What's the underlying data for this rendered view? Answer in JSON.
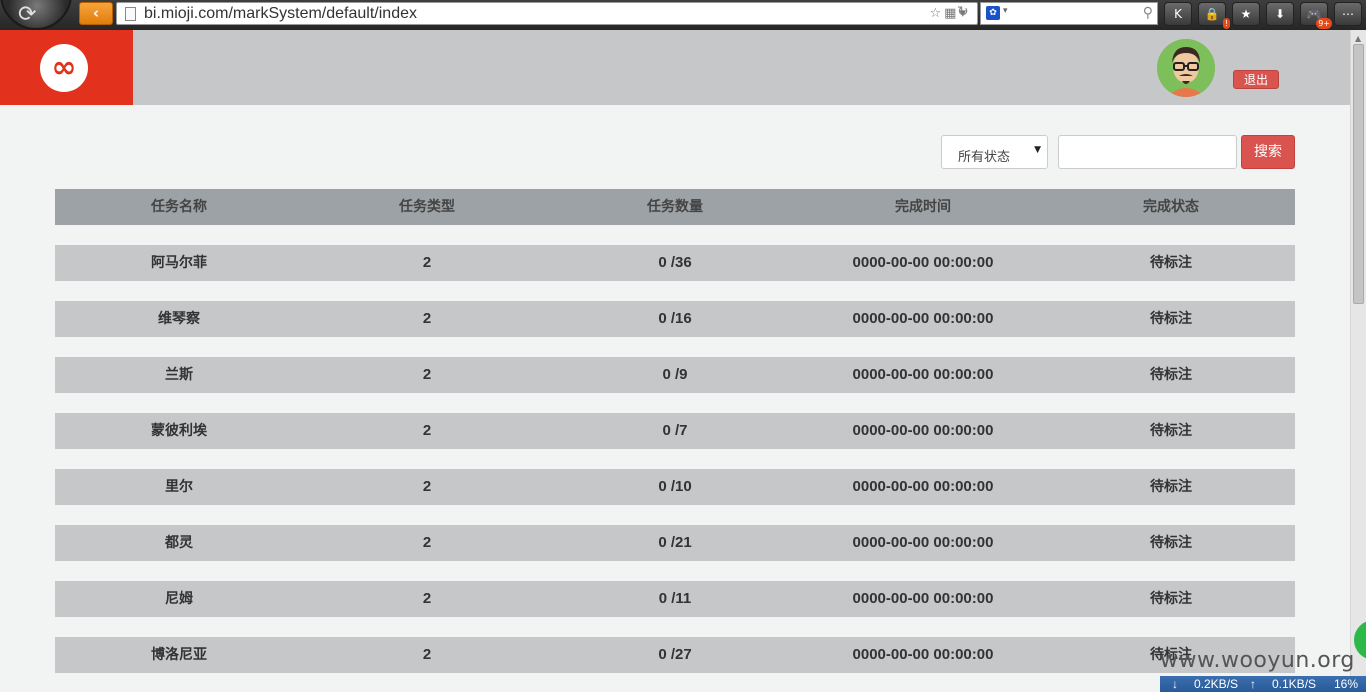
{
  "browser": {
    "url": "bi.mioji.com/markSystem/default/index",
    "back_icon": "‹",
    "search_engine_icon": "paw-icon",
    "toolbar_buttons": [
      {
        "name": "k-extension-button",
        "glyph": "K",
        "badge": ""
      },
      {
        "name": "lock-button",
        "glyph": "🔒",
        "badge": "!"
      },
      {
        "name": "bookmark-star-button",
        "glyph": "★",
        "badge": ""
      },
      {
        "name": "download-button",
        "glyph": "⬇",
        "badge": ""
      },
      {
        "name": "game-button",
        "glyph": "🎮",
        "badge": "9+"
      },
      {
        "name": "more-button",
        "glyph": "⋯",
        "badge": ""
      }
    ]
  },
  "header": {
    "logo_glyph": "∞",
    "logout_label": "退出"
  },
  "filters": {
    "status_select_value": "所有状态",
    "search_value": "",
    "search_button_label": "搜索"
  },
  "table": {
    "columns": [
      "任务名称",
      "任务类型",
      "任务数量",
      "完成时间",
      "完成状态"
    ],
    "rows": [
      {
        "name": "阿马尔菲",
        "type": "2",
        "count": "0 /36",
        "time": "0000-00-00 00:00:00",
        "status": "待标注"
      },
      {
        "name": "维琴察",
        "type": "2",
        "count": "0 /16",
        "time": "0000-00-00 00:00:00",
        "status": "待标注"
      },
      {
        "name": "兰斯",
        "type": "2",
        "count": "0 /9",
        "time": "0000-00-00 00:00:00",
        "status": "待标注"
      },
      {
        "name": "蒙彼利埃",
        "type": "2",
        "count": "0 /7",
        "time": "0000-00-00 00:00:00",
        "status": "待标注"
      },
      {
        "name": "里尔",
        "type": "2",
        "count": "0 /10",
        "time": "0000-00-00 00:00:00",
        "status": "待标注"
      },
      {
        "name": "都灵",
        "type": "2",
        "count": "0 /21",
        "time": "0000-00-00 00:00:00",
        "status": "待标注"
      },
      {
        "name": "尼姆",
        "type": "2",
        "count": "0 /11",
        "time": "0000-00-00 00:00:00",
        "status": "待标注"
      },
      {
        "name": "博洛尼亚",
        "type": "2",
        "count": "0 /27",
        "time": "0000-00-00 00:00:00",
        "status": "待标注"
      }
    ]
  },
  "watermark": "www.wooyun.org",
  "status_bar": {
    "download_speed": "0.2KB/S",
    "upload_speed": "0.1KB/S",
    "percent": "16%"
  },
  "colors": {
    "brand_red": "#e2311d",
    "button_red": "#d9534f",
    "header_gray": "#c6c7c8",
    "table_head_gray": "#9ca2a6"
  }
}
